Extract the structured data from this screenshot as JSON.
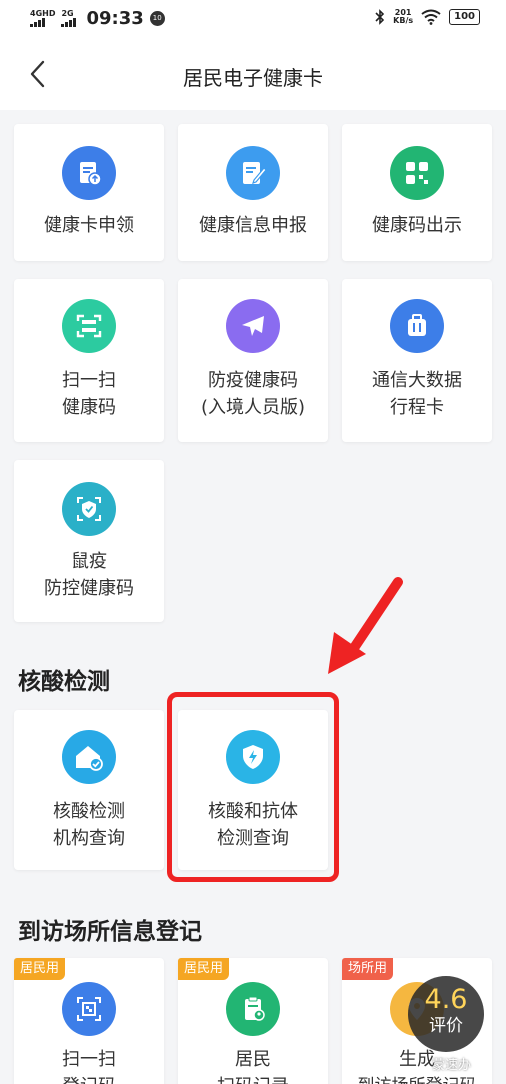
{
  "status_bar": {
    "network_1": "4GHD",
    "network_2": "2G",
    "time": "09:33",
    "badge": "10",
    "speed_value": "201",
    "speed_unit": "KB/s",
    "battery": "100"
  },
  "nav": {
    "title": "居民电子健康卡"
  },
  "services": {
    "apply_card": {
      "label": "健康卡申领",
      "icon_color": "#3d7ee8"
    },
    "info_report": {
      "label": "健康信息申报",
      "icon_color": "#3d9cef"
    },
    "show_code": {
      "label": "健康码出示",
      "icon_color": "#22b573"
    },
    "scan_code": {
      "line1": "扫一扫",
      "line2": "健康码",
      "icon_color": "#2ccba0"
    },
    "entry_code": {
      "line1": "防疫健康码",
      "line2": "(入境人员版)",
      "icon_color": "#8a6cf0"
    },
    "trip_card": {
      "line1": "通信大数据",
      "line2": "行程卡",
      "icon_color": "#3d7ee8"
    },
    "plague_code": {
      "line1": "鼠疫",
      "line2": "防控健康码",
      "icon_color": "#2ab0c8"
    }
  },
  "nucleic": {
    "title": "核酸检测",
    "institution": {
      "line1": "核酸检测",
      "line2": "机构查询",
      "icon_color": "#28a9e6"
    },
    "result": {
      "line1": "核酸和抗体",
      "line2": "检测查询",
      "icon_color": "#2ab4e6"
    }
  },
  "visit": {
    "title": "到访场所信息登记",
    "items": [
      {
        "tag": "居民用",
        "tag_color": "#f5a623",
        "line1": "扫一扫",
        "line2": "登记码",
        "icon_color": "#3d7ee8"
      },
      {
        "tag": "居民用",
        "tag_color": "#f5a623",
        "line1": "居民",
        "line2": "扫码记录",
        "icon_color": "#22b573"
      },
      {
        "tag": "场所用",
        "tag_color": "#f0614a",
        "line1": "生成",
        "line2": "到访场所登记码",
        "icon_color": "#f5b740"
      }
    ]
  },
  "highlight_color": "#ee2323",
  "rating": {
    "score": "4.6",
    "label": "评价"
  },
  "watermark": "蒙速办"
}
